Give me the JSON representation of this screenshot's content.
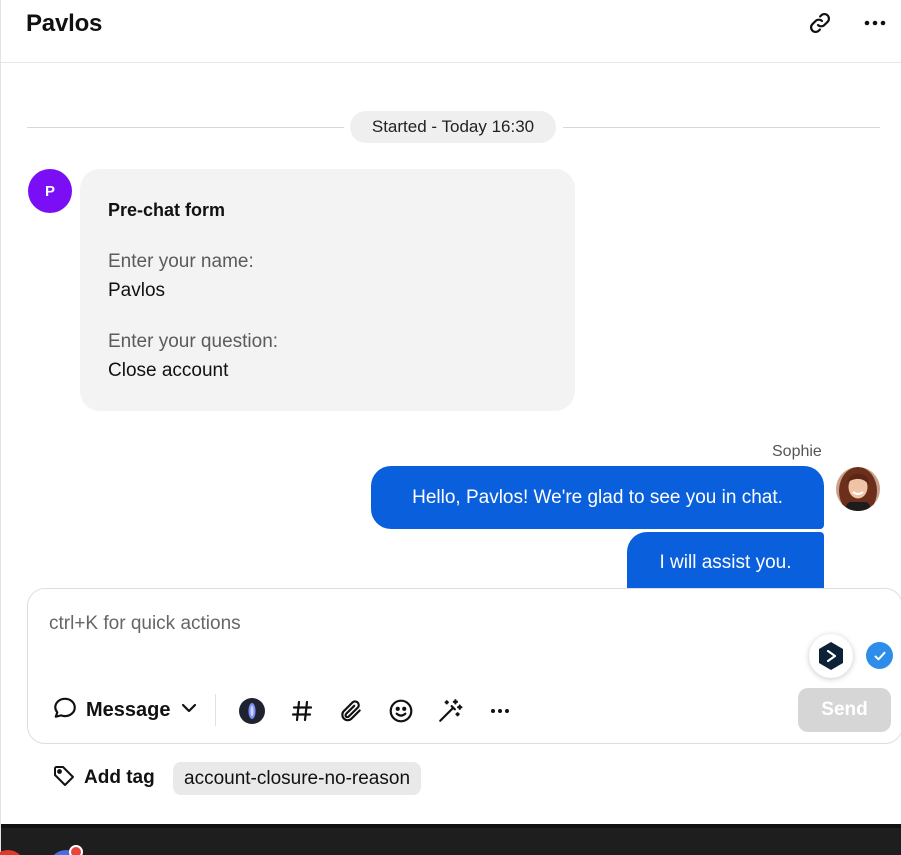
{
  "header": {
    "title": "Pavlos",
    "link_icon": "link-icon",
    "more_icon": "more-horizontal-icon"
  },
  "conversation": {
    "started_label": "Started - Today 16:30",
    "prechat": {
      "avatar_initial": "P",
      "avatar_color": "#7a0ff5",
      "title": "Pre-chat form",
      "fields": [
        {
          "label": "Enter your name:",
          "value": "Pavlos"
        },
        {
          "label": "Enter your question:",
          "value": "Close account"
        }
      ]
    },
    "agent": {
      "name": "Sophie",
      "messages": [
        "Hello, Pavlos! We're glad to see you in chat.",
        "I will assist you."
      ],
      "bubble_color": "#0a5fdc"
    }
  },
  "composer": {
    "placeholder": "ctrl+K for quick actions",
    "mode_label": "Message",
    "send_label": "Send",
    "toolbar_icons": [
      "ai-assistant-icon",
      "hashtag-icon",
      "paperclip-icon",
      "emoji-icon",
      "magic-wand-icon",
      "more-horizontal-icon"
    ]
  },
  "tags": {
    "add_label": "Add tag",
    "items": [
      "account-closure-no-reason"
    ]
  }
}
